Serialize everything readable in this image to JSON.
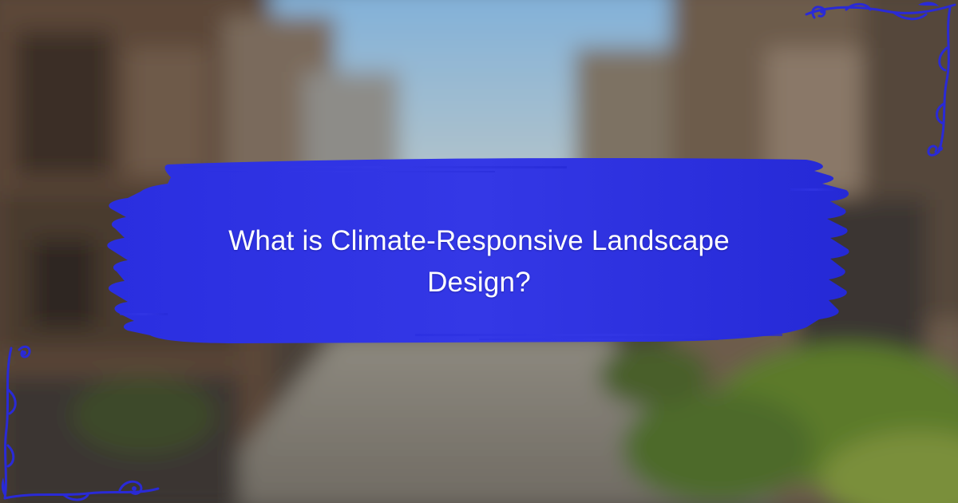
{
  "title": "What is Climate-Responsive Landscape Design?",
  "colors": {
    "banner": "#2b2fe0",
    "banner_dark": "#1f22c8",
    "flourish": "#2a2ad6",
    "sky": "#8fb8d8",
    "buildings_left": "#5a4636",
    "buildings_right": "#6a5a4a",
    "street": "#8a8278",
    "foliage": "#5e7a2e"
  },
  "icons": {
    "top_right": "ornate-corner-flourish-icon",
    "bottom_left": "ornate-corner-flourish-icon"
  }
}
